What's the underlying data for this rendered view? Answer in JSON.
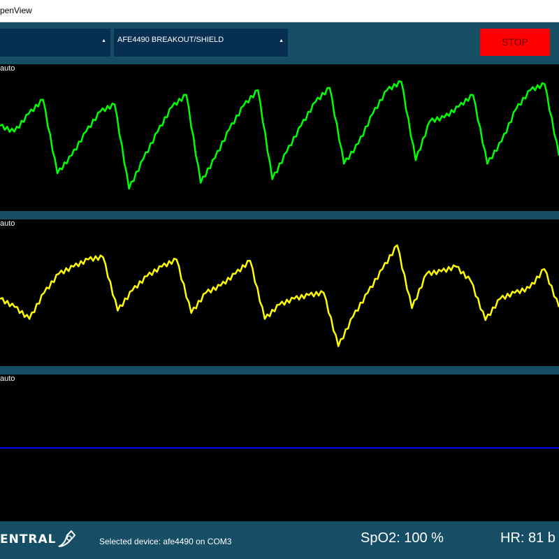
{
  "window": {
    "title": "penView"
  },
  "toolbar": {
    "port_dropdown": {
      "value": ""
    },
    "board_dropdown": {
      "value": "AFE4490 BREAKOUT/SHIELD"
    },
    "stop_label": "STOP",
    "arrow_glyph": "▲"
  },
  "plots": [
    {
      "scale_label": "auto",
      "color": "#00ff00"
    },
    {
      "scale_label": "auto",
      "color": "#ffff00"
    },
    {
      "scale_label": "auto",
      "color": "#0000ff"
    }
  ],
  "footer": {
    "logo_text": "ENTRAL",
    "device_text": "Selected device: afe4490 on COM3",
    "spo2_text": "SpO2: 100 %",
    "hr_text": "HR: 81 b"
  },
  "chart_data": [
    {
      "type": "line",
      "series": [
        {
          "color": "#00ff00",
          "values": [
            0.6,
            0.55,
            0.7,
            0.82,
            0.2,
            0.35,
            0.55,
            0.72,
            0.78,
            0.07,
            0.32,
            0.55,
            0.76,
            0.86,
            0.12,
            0.33,
            0.57,
            0.77,
            0.9,
            0.15,
            0.38,
            0.6,
            0.8,
            0.92,
            0.28,
            0.45,
            0.7,
            0.9,
            0.97,
            0.31,
            0.64,
            0.67,
            0.76,
            0.86,
            0.28,
            0.47,
            0.74,
            0.9,
            0.95,
            0.35
          ]
        }
      ],
      "ylim": [
        0,
        1
      ]
    },
    {
      "type": "line",
      "series": [
        {
          "color": "#ffff00",
          "values": [
            0.45,
            0.38,
            0.28,
            0.5,
            0.66,
            0.72,
            0.78,
            0.8,
            0.35,
            0.52,
            0.64,
            0.72,
            0.78,
            0.33,
            0.5,
            0.56,
            0.66,
            0.77,
            0.28,
            0.4,
            0.45,
            0.48,
            0.5,
            0.05,
            0.3,
            0.5,
            0.7,
            0.9,
            0.37,
            0.66,
            0.68,
            0.72,
            0.6,
            0.27,
            0.45,
            0.5,
            0.54,
            0.7,
            0.38
          ]
        }
      ],
      "ylim": [
        0,
        1
      ]
    },
    {
      "type": "line",
      "series": [
        {
          "color": "#0000ff",
          "values": [
            0.5,
            0.5,
            0.5,
            0.5,
            0.5
          ]
        }
      ],
      "ylim": [
        0,
        1
      ]
    }
  ]
}
